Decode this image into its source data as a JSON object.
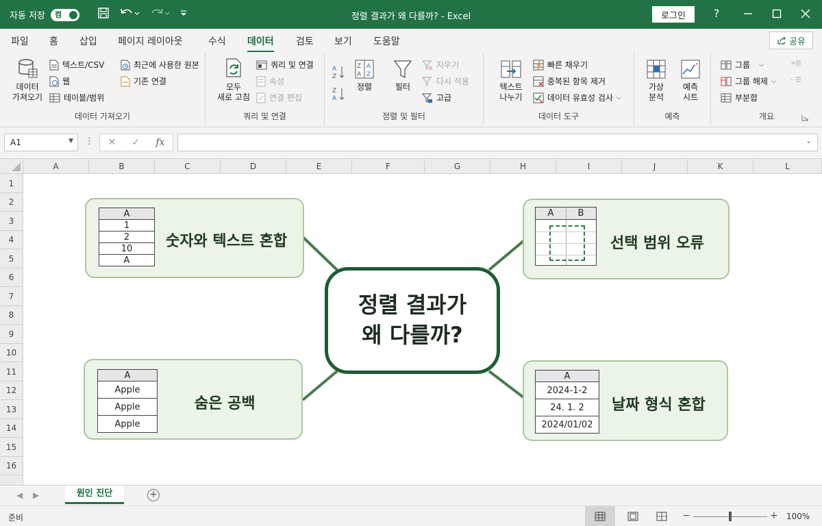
{
  "titlebar": {
    "autosave_label": "자동 저장",
    "autosave_state": "켬",
    "title": "정렬 결과가 왜 다를까? - Excel",
    "login_label": "로그인",
    "help_label": "?"
  },
  "menu": {
    "tabs": [
      "파일",
      "홈",
      "삽입",
      "페이지 레이아웃",
      "수식",
      "데이터",
      "검토",
      "보기",
      "도움말"
    ],
    "active": "데이터",
    "share_label": "공유"
  },
  "ribbon": {
    "get_data": {
      "group_label": "데이터 가져오기",
      "big_button_line1": "데이터",
      "big_button_line2": "가져오기",
      "text_csv": "텍스트/CSV",
      "web": "웹",
      "table_range": "테이블/범위",
      "recent_sources": "최근에 사용한 원본",
      "existing_connections": "기존 연결"
    },
    "queries": {
      "group_label": "쿼리 및 연결",
      "refresh_line1": "모두",
      "refresh_line2": "새로 고침",
      "queries_connections": "쿼리 및 연결",
      "properties": "속성",
      "edit_links": "연결 편집"
    },
    "sort_filter": {
      "group_label": "정렬 및 필터",
      "sort": "정렬",
      "filter": "필터",
      "clear": "지우기",
      "reapply": "다시 적용",
      "advanced": "고급"
    },
    "data_tools": {
      "group_label": "데이터 도구",
      "text_to_columns_line1": "텍스트",
      "text_to_columns_line2": "나누기",
      "flash_fill": "빠른 채우기",
      "remove_duplicates": "중복된 항목 제거",
      "data_validation": "데이터 유효성 검사"
    },
    "forecast": {
      "group_label": "예측",
      "what_if_line1": "가상",
      "what_if_line2": "분석",
      "forecast_sheet_line1": "예측",
      "forecast_sheet_line2": "시트"
    },
    "outline": {
      "group_label": "개요",
      "group": "그룹",
      "ungroup": "그룹 해제",
      "subtotal": "부분합"
    }
  },
  "formula_bar": {
    "name_box": "A1",
    "fx": "fx",
    "formula": ""
  },
  "grid": {
    "columns": [
      "A",
      "B",
      "C",
      "D",
      "E",
      "F",
      "G",
      "H",
      "I",
      "J",
      "K",
      "L"
    ],
    "rows": [
      "1",
      "2",
      "3",
      "4",
      "5",
      "6",
      "7",
      "8",
      "9",
      "10",
      "11",
      "12",
      "13",
      "14",
      "15",
      "16"
    ]
  },
  "mindmap": {
    "center_line1": "정렬 결과가",
    "center_line2": "왜 다를까?",
    "mixed": {
      "title": "숫자와 텍스트 혼합",
      "header": "A",
      "cells": [
        "1",
        "2",
        "10",
        "A"
      ]
    },
    "selection": {
      "title": "선택 범위 오류",
      "headers": [
        "A",
        "B"
      ]
    },
    "hidden_space": {
      "title": "숨은 공백",
      "header": "A",
      "cells": [
        "Apple",
        "Apple",
        "Apple"
      ]
    },
    "date_format": {
      "title": "날짜 형식 혼합",
      "header": "A",
      "cells": [
        "2024-1-2",
        "24. 1. 2",
        "2024/01/02"
      ]
    },
    "colors": {
      "node_fill": "#ecf3e8",
      "node_border": "#a9c79c",
      "center_border": "#1d5c31",
      "connector": "#4a7a4f",
      "excel_green": "#217346"
    }
  },
  "sheet_tabs": {
    "active": "원인 진단",
    "add_label": "+"
  },
  "statusbar": {
    "status": "준비",
    "zoom": "100%",
    "zoom_fraction": 0.5
  }
}
